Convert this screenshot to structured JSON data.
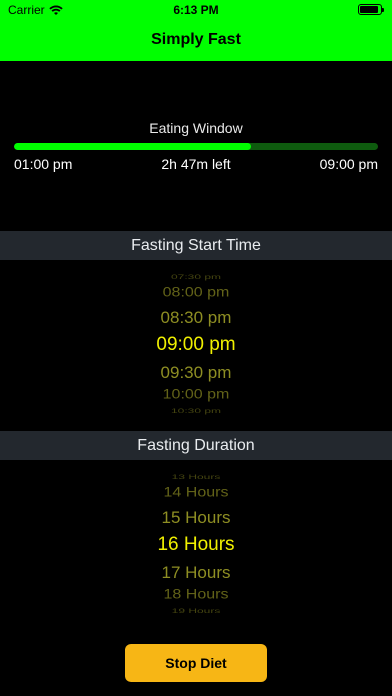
{
  "status_bar": {
    "carrier": "Carrier",
    "time": "6:13 PM",
    "wifi_icon": "wifi-icon",
    "battery_icon": "battery-icon"
  },
  "header": {
    "title": "Simply Fast",
    "color": "#00ff00"
  },
  "eating_window": {
    "label": "Eating Window",
    "start": "01:00 pm",
    "remaining": "2h 47m left",
    "end": "09:00 pm",
    "progress": 0.65
  },
  "fasting_start": {
    "label": "Fasting Start Time",
    "options": [
      "07:30 pm",
      "08:00 pm",
      "08:30 pm",
      "09:00 pm",
      "09:30 pm",
      "10:00 pm",
      "10:30 pm"
    ],
    "selected_index": 3
  },
  "fasting_duration": {
    "label": "Fasting Duration",
    "options": [
      "13 Hours",
      "14 Hours",
      "15 Hours",
      "16 Hours",
      "17 Hours",
      "18 Hours",
      "19 Hours"
    ],
    "selected_index": 3
  },
  "actions": {
    "stop_label": "Stop Diet"
  },
  "colors": {
    "accent_green": "#00ff00",
    "picker_selected": "#f0f000",
    "picker_faded": "#b2b22c",
    "button_bg": "#f7b615"
  }
}
